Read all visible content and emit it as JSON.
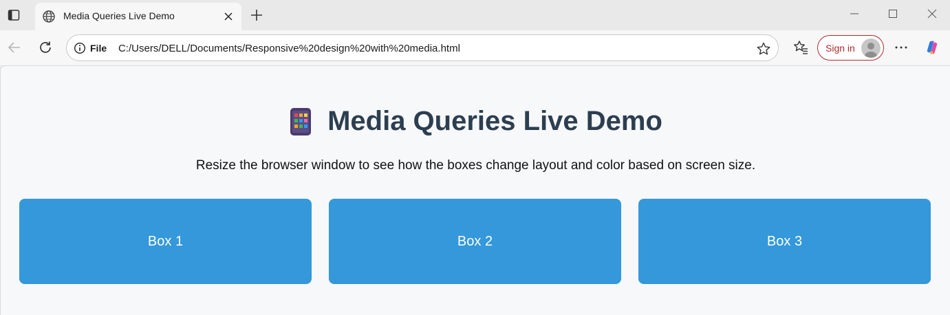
{
  "browser": {
    "tab": {
      "title": "Media Queries Live Demo"
    },
    "address": {
      "scheme": "File",
      "url": "C:/Users/DELL/Documents/Responsive%20design%20with%20media.html"
    },
    "signin_label": "Sign in"
  },
  "page": {
    "title": "Media Queries Live Demo",
    "subtitle": "Resize the browser window to see how the boxes change layout and color based on screen size.",
    "boxes": [
      "Box 1",
      "Box 2",
      "Box 3"
    ],
    "box_color": "#3498db",
    "title_color": "#2c3e50"
  }
}
